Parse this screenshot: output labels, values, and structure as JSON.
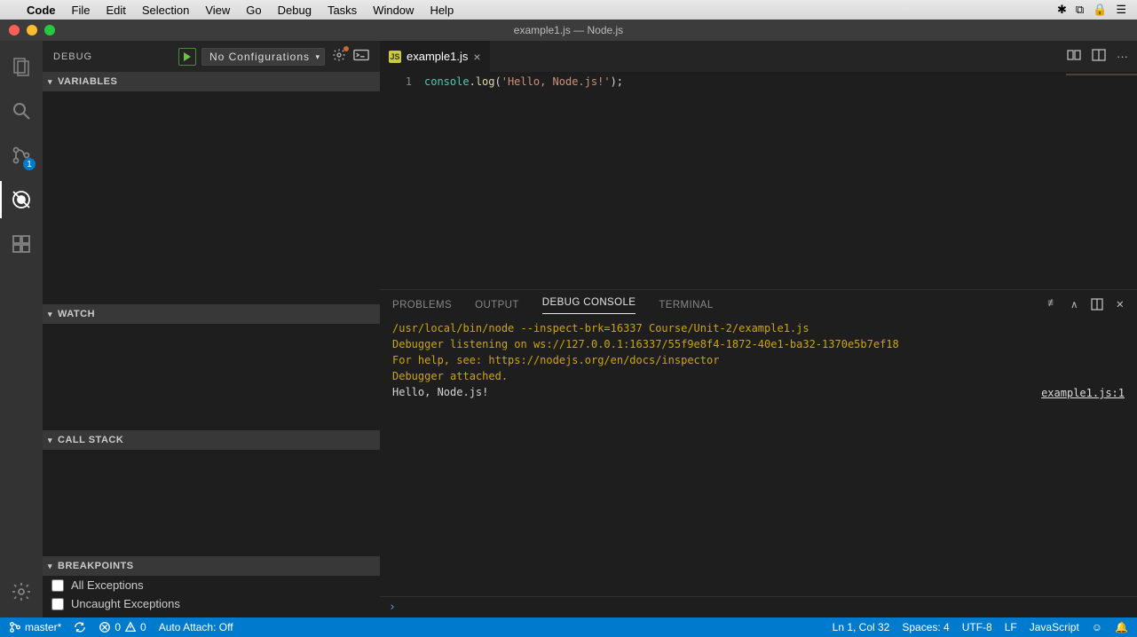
{
  "menubar": {
    "app": "Code",
    "items": [
      "File",
      "Edit",
      "Selection",
      "View",
      "Go",
      "Debug",
      "Tasks",
      "Window",
      "Help"
    ]
  },
  "window": {
    "title": "example1.js — Node.js"
  },
  "activity": {
    "scm_badge": "1"
  },
  "debug": {
    "title": "DEBUG",
    "config_selected": "No Configurations",
    "sections": {
      "variables": "VARIABLES",
      "watch": "WATCH",
      "callstack": "CALL STACK",
      "breakpoints": "BREAKPOINTS"
    },
    "breakpoints": [
      {
        "label": "All Exceptions",
        "checked": false
      },
      {
        "label": "Uncaught Exceptions",
        "checked": false
      }
    ]
  },
  "editor": {
    "tab_name": "example1.js",
    "line_no": "1",
    "code_tokens": {
      "obj": "console",
      "dot": ".",
      "fn": "log",
      "open": "(",
      "str": "'Hello, Node.js!'",
      "close": ")",
      "semi": ";"
    }
  },
  "panel": {
    "tabs": {
      "problems": "PROBLEMS",
      "output": "OUTPUT",
      "debug_console": "DEBUG CONSOLE",
      "terminal": "TERMINAL"
    },
    "console": {
      "line1": "/usr/local/bin/node --inspect-brk=16337 Course/Unit-2/example1.js",
      "line2": "Debugger listening on ws://127.0.0.1:16337/55f9e8f4-1872-40e1-ba32-1370e5b7ef18",
      "line3": "For help, see: https://nodejs.org/en/docs/inspector",
      "line4": "Debugger attached.",
      "out": "Hello, Node.js!",
      "source": "example1.js:1"
    },
    "repl_prompt": "›"
  },
  "status": {
    "branch": "master*",
    "errors": "0",
    "warnings": "0",
    "auto_attach": "Auto Attach: Off",
    "cursor": "Ln 1, Col 32",
    "spaces": "Spaces: 4",
    "encoding": "UTF-8",
    "eol": "LF",
    "language": "JavaScript"
  }
}
